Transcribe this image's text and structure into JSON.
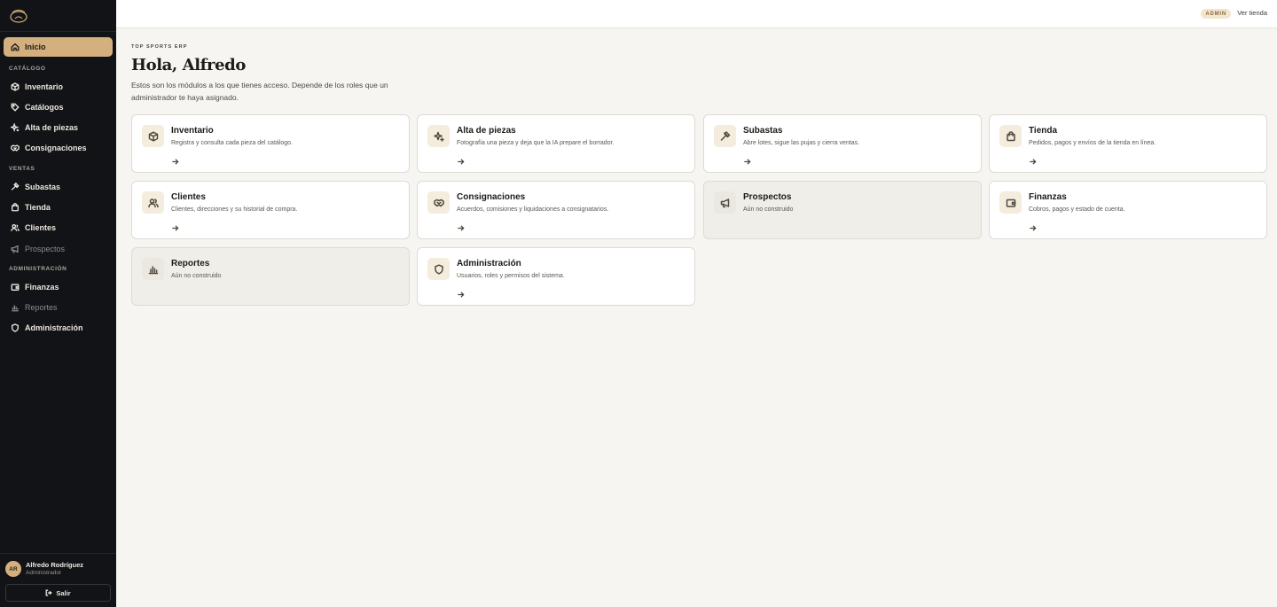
{
  "sidebar": {
    "items": [
      {
        "label": "Inicio",
        "icon": "home-icon"
      },
      {
        "label": "Inventario",
        "icon": "box-icon"
      },
      {
        "label": "Catálogos",
        "icon": "tag-icon"
      },
      {
        "label": "Alta de piezas",
        "icon": "sparkle-icon"
      },
      {
        "label": "Consignaciones",
        "icon": "handshake-icon"
      },
      {
        "label": "Subastas",
        "icon": "gavel-icon"
      },
      {
        "label": "Tienda",
        "icon": "bag-icon"
      },
      {
        "label": "Clientes",
        "icon": "users-icon"
      },
      {
        "label": "Prospectos",
        "icon": "megaphone-icon"
      },
      {
        "label": "Finanzas",
        "icon": "wallet-icon"
      },
      {
        "label": "Reportes",
        "icon": "chart-icon"
      },
      {
        "label": "Administración",
        "icon": "shield-icon"
      }
    ],
    "sections": {
      "catalogo": "CATÁLOGO",
      "ventas": "VENTAS",
      "administracion": "ADMINISTRACIÓN"
    },
    "user": {
      "initials": "AR",
      "name": "Alfredo Rodríguez",
      "role": "Administrador"
    },
    "logout_label": "Salir"
  },
  "topbar": {
    "badge": "ADMIN",
    "store_link": "Ver tienda"
  },
  "main": {
    "eyebrow": "TOP SPORTS ERP",
    "greeting": "Hola, Alfredo",
    "intro": "Estos son los módulos a los que tienes acceso. Depende de los roles que un administrador te haya asignado.",
    "cards": [
      {
        "title": "Inventario",
        "desc": "Registra y consulta cada pieza del catálogo.",
        "icon": "box-icon"
      },
      {
        "title": "Alta de piezas",
        "desc": "Fotografía una pieza y deja que la IA prepare el borrador.",
        "icon": "sparkle-icon"
      },
      {
        "title": "Subastas",
        "desc": "Abre lotes, sigue las pujas y cierra ventas.",
        "icon": "gavel-icon"
      },
      {
        "title": "Tienda",
        "desc": "Pedidos, pagos y envíos de la tienda en línea.",
        "icon": "bag-icon"
      },
      {
        "title": "Clientes",
        "desc": "Clientes, direcciones y su historial de compra.",
        "icon": "users-icon"
      },
      {
        "title": "Consignaciones",
        "desc": "Acuerdos, comisiones y liquidaciones a consignatarios.",
        "icon": "handshake-icon"
      },
      {
        "title": "Prospectos",
        "desc": "Aún no construido",
        "icon": "megaphone-icon"
      },
      {
        "title": "Finanzas",
        "desc": "Cobros, pagos y estado de cuenta.",
        "icon": "wallet-icon"
      },
      {
        "title": "Reportes",
        "desc": "Aún no construido",
        "icon": "chart-icon"
      },
      {
        "title": "Administración",
        "desc": "Usuarios, roles y permisos del sistema.",
        "icon": "shield-icon"
      }
    ]
  },
  "colors": {
    "sidebar_bg": "#121316",
    "accent": "#d4b07e",
    "page_bg": "#f6f5f1",
    "card_bg": "#ffffff",
    "card_disabled_bg": "#f0eee9"
  }
}
